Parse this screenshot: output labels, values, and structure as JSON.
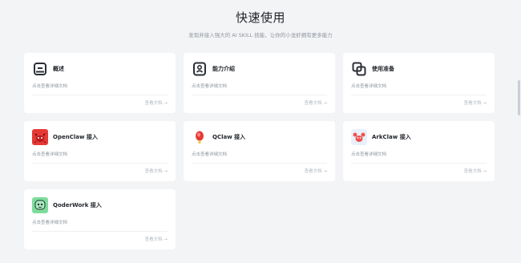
{
  "header": {
    "title": "快速使用",
    "subtitle": "发现并接入强大的 AI SKILL 技能，让你的小龙虾拥有更多能力"
  },
  "cards": [
    {
      "title": "概述",
      "desc": "点击查看详细文档",
      "link": "查看文档 →",
      "icon": "overview-doc-icon"
    },
    {
      "title": "能力介绍",
      "desc": "点击查看详细文档",
      "link": "查看文档 →",
      "icon": "capability-icon"
    },
    {
      "title": "使用准备",
      "desc": "点击查看详细文档",
      "link": "查看文档 →",
      "icon": "preparation-icon"
    },
    {
      "title": "OpenClaw 接入",
      "desc": "点击查看详细文档",
      "link": "查看文档 →",
      "icon": "openclaw-logo-icon"
    },
    {
      "title": "QClaw 接入",
      "desc": "点击查看详细文档",
      "link": "查看文档 →",
      "icon": "qclaw-logo-icon"
    },
    {
      "title": "ArkClaw 接入",
      "desc": "点击查看详细文档",
      "link": "查看文档 →",
      "icon": "arkclaw-logo-icon"
    },
    {
      "title": "QoderWork 接入",
      "desc": "点击查看详细文档",
      "link": "查看文档 →",
      "icon": "qoderwork-logo-icon"
    }
  ],
  "colors": {
    "background": "#f3f4f6",
    "card": "#ffffff",
    "title_text": "#1f2329",
    "muted_text": "#8f959e",
    "openclaw_red": "#e53935",
    "qoderwork_green": "#7ddc9a"
  }
}
